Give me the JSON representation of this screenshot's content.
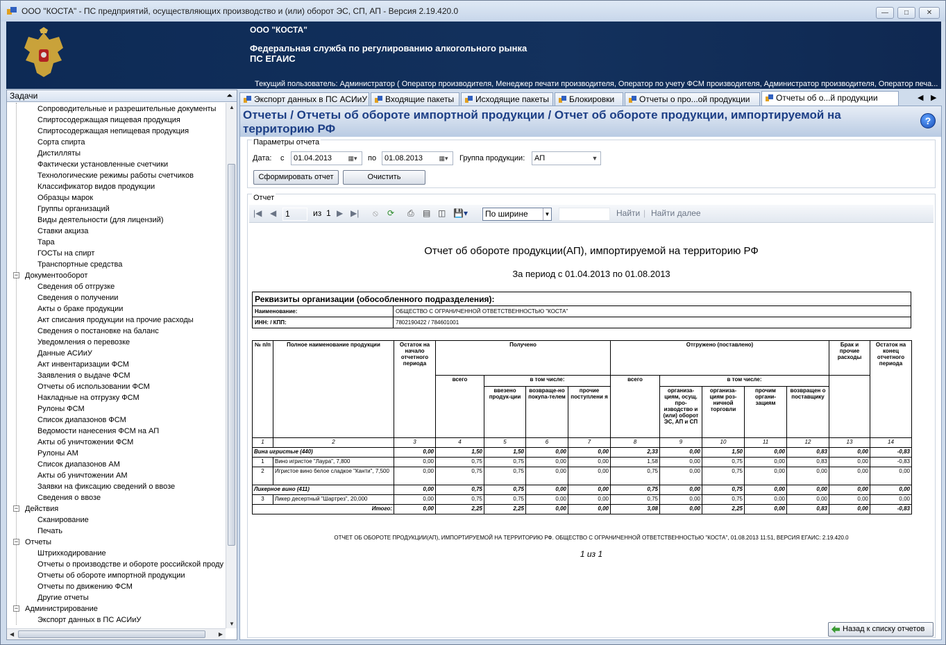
{
  "window": {
    "title": "ООО \"КОСТА\" - ПС предприятий, осуществляющих производство и (или) оборот ЭС, СП, АП - Версия 2.19.420.0",
    "min_icon": "minimize-icon",
    "max_icon": "maximize-icon",
    "close_icon": "close-icon"
  },
  "banner": {
    "org": "ООО \"КОСТА\"",
    "agency": "Федеральная служба по регулированию алкогольного рынка",
    "system": "ПС ЕГАИС",
    "user": "Текущий пользователь: Администратор ( Оператор производителя, Менеджер печати производителя, Оператор по учету ФСМ производителя, Администратор производителя, Оператор печа..."
  },
  "tasks": {
    "title": "Задачи",
    "pin": "ᚡ",
    "items": [
      {
        "label": "Сопроводительные и разрешительные документы",
        "level": 1
      },
      {
        "label": "Спиртосодержащая пищевая продукция",
        "level": 1
      },
      {
        "label": "Спиртосодержащая непищевая продукция",
        "level": 1
      },
      {
        "label": "Сорта спирта",
        "level": 1
      },
      {
        "label": "Дистилляты",
        "level": 1
      },
      {
        "label": "Фактически установленные счетчики",
        "level": 1
      },
      {
        "label": "Технологические режимы работы счетчиков",
        "level": 1
      },
      {
        "label": "Классификатор видов продукции",
        "level": 1
      },
      {
        "label": "Образцы марок",
        "level": 1
      },
      {
        "label": "Группы организаций",
        "level": 1
      },
      {
        "label": "Виды деятельности (для лицензий)",
        "level": 1
      },
      {
        "label": "Ставки акциза",
        "level": 1
      },
      {
        "label": "Тара",
        "level": 1
      },
      {
        "label": "ГОСТы на спирт",
        "level": 1
      },
      {
        "label": "Транспортные средства",
        "level": 1
      },
      {
        "label": "Документооборот",
        "level": 0
      },
      {
        "label": "Сведения об отгрузке",
        "level": 1
      },
      {
        "label": "Сведения о получении",
        "level": 1
      },
      {
        "label": "Акты о браке продукции",
        "level": 1
      },
      {
        "label": "Акт списания продукции на прочие расходы",
        "level": 1
      },
      {
        "label": "Сведения о постановке на баланс",
        "level": 1
      },
      {
        "label": "Уведомления о перевозке",
        "level": 1
      },
      {
        "label": "Данные АСИиУ",
        "level": 1
      },
      {
        "label": "Акт инвентаризации ФСМ",
        "level": 1
      },
      {
        "label": "Заявления о выдаче ФСМ",
        "level": 1
      },
      {
        "label": "Отчеты об использовании ФСМ",
        "level": 1
      },
      {
        "label": "Накладные на отгрузку ФСМ",
        "level": 1
      },
      {
        "label": "Рулоны ФСМ",
        "level": 1
      },
      {
        "label": "Список диапазонов ФСМ",
        "level": 1
      },
      {
        "label": "Ведомости нанесения ФСМ на АП",
        "level": 1
      },
      {
        "label": "Акты об уничтожении ФСМ",
        "level": 1
      },
      {
        "label": "Рулоны АМ",
        "level": 1
      },
      {
        "label": "Список диапазонов АМ",
        "level": 1
      },
      {
        "label": "Акты об уничтожении АМ",
        "level": 1
      },
      {
        "label": "Заявки на фиксацию сведений о ввозе",
        "level": 1
      },
      {
        "label": "Сведения о ввозе",
        "level": 1
      },
      {
        "label": "Действия",
        "level": 0
      },
      {
        "label": "Сканирование",
        "level": 1
      },
      {
        "label": "Печать",
        "level": 1
      },
      {
        "label": "Отчеты",
        "level": 0
      },
      {
        "label": "Штрихкодирование",
        "level": 1
      },
      {
        "label": "Отчеты о производстве и обороте российской проду",
        "level": 1
      },
      {
        "label": "Отчеты об обороте импортной продукции",
        "level": 1
      },
      {
        "label": "Отчеты по движению ФСМ",
        "level": 1
      },
      {
        "label": "Другие отчеты",
        "level": 1
      },
      {
        "label": "Администрирование",
        "level": 0
      },
      {
        "label": "Экспорт данных в ПС АСИиУ",
        "level": 1
      }
    ],
    "scroll_icon": "scrollbar"
  },
  "tabs": [
    {
      "label": "Экспорт данных в ПС АСИиУ"
    },
    {
      "label": "Входящие пакеты"
    },
    {
      "label": "Исходящие пакеты"
    },
    {
      "label": "Блокировки"
    },
    {
      "label": "Отчеты о про...ой продукции"
    },
    {
      "label": "Отчеты об о...й продукции"
    }
  ],
  "tab_nav": {
    "left": "◀",
    "right": "▶"
  },
  "page": {
    "title": "Отчеты / Отчеты об обороте импортной продукции / Отчет об обороте продукции, импортируемой на территорию РФ",
    "help": "?"
  },
  "params": {
    "legend": "Параметры отчета",
    "date_label": "Дата:",
    "from_label": "с",
    "from_value": "01.04.2013",
    "to_label": "по",
    "to_value": "01.08.2013",
    "group_label": "Группа продукции:",
    "group_value": "АП",
    "generate": "Сформировать отчет",
    "clear": "Очистить"
  },
  "report_toolbar": {
    "legend": "Отчет",
    "page_value": "1",
    "of_label": "из",
    "of_value": "1",
    "zoom": "По ширине",
    "find": "Найти",
    "find_next": "Найти далее",
    "separator": "|"
  },
  "report": {
    "title": "Отчет об обороте продукции(АП), импортируемой на территорию РФ",
    "period": "За период с 01.04.2013 по 01.08.2013",
    "req_header": "Реквизиты организации (обособленного подразделения):",
    "name_label": "Наименование:",
    "name_value": "ОБЩЕСТВО С ОГРАНИЧЕННОЙ ОТВЕТСТВЕННОСТЬЮ \"КОСТА\"",
    "inn_label": "ИНН: / КПП:",
    "inn_value": "7802190422 / 784601001",
    "h": {
      "num": "№ п/п",
      "name": "Полное наименование продукции",
      "start": "Остаток на начало отчетного периода",
      "received": "Получено",
      "shipped": "Отгружено (поставлено)",
      "defect": "Брак и прочие расходы",
      "end": "Остаток на конец отчетного периода",
      "total": "всего",
      "including": "в том числе:",
      "imported": "ввезено продук-ции",
      "returned": "возвраще-но покупа-телем",
      "other_in": "прочие поступлени я",
      "orgs": "организа-циям, осущ. про-изводство и (или) оборот ЭС, АП и СП",
      "retail": "организа-циям роз-ничной торговли",
      "other_orgs": "прочим органи-зациям",
      "supplier": "возвращен о поставщику"
    },
    "index": [
      "1",
      "2",
      "3",
      "4",
      "5",
      "6",
      "7",
      "8",
      "9",
      "10",
      "11",
      "12",
      "13",
      "14"
    ],
    "rows": [
      {
        "type": "group",
        "name": "Вина игристые (440)",
        "v": [
          "0,00",
          "1,50",
          "1,50",
          "0,00",
          "0,00",
          "2,33",
          "0,00",
          "1,50",
          "0,00",
          "0,83",
          "0,00",
          "-0,83"
        ]
      },
      {
        "type": "item",
        "n": "1",
        "name": "Вино игристое \"Лаура\", 7,800",
        "v": [
          "0,00",
          "0,75",
          "0,75",
          "0,00",
          "0,00",
          "1,58",
          "0,00",
          "0,75",
          "0,00",
          "0,83",
          "0,00",
          "-0,83"
        ]
      },
      {
        "type": "item",
        "n": "2",
        "name": "Игристое вино белое сладкое \"Канти\", 7,500",
        "v": [
          "0,00",
          "0,75",
          "0,75",
          "0,00",
          "0,00",
          "0,75",
          "0,00",
          "0,75",
          "0,00",
          "0,00",
          "0,00",
          "0,00"
        ]
      },
      {
        "type": "group",
        "name": "Ликерное вино (411)",
        "v": [
          "0,00",
          "0,75",
          "0,75",
          "0,00",
          "0,00",
          "0,75",
          "0,00",
          "0,75",
          "0,00",
          "0,00",
          "0,00",
          "0,00"
        ]
      },
      {
        "type": "item",
        "n": "3",
        "name": "Ликер десертный \"Шартрез\", 20,000",
        "v": [
          "0,00",
          "0,75",
          "0,75",
          "0,00",
          "0,00",
          "0,75",
          "0,00",
          "0,75",
          "0,00",
          "0,00",
          "0,00",
          "0,00"
        ]
      },
      {
        "type": "total",
        "name": "Итого:",
        "v": [
          "0,00",
          "2,25",
          "2,25",
          "0,00",
          "0,00",
          "3,08",
          "0,00",
          "2,25",
          "0,00",
          "0,83",
          "0,00",
          "-0,83"
        ]
      }
    ],
    "footer": "ОТЧЕТ ОБ ОБОРОТЕ ПРОДУКЦИИ(АП), ИМПОРТИРУЕМОЙ НА ТЕРРИТОРИЮ РФ. ОБЩЕСТВО С ОГРАНИЧЕННОЙ ОТВЕТСТВЕННОСТЬЮ \"КОСТА\", 01.08.2013 11:51, ВЕРСИЯ ЕГАИС: 2.19.420.0",
    "page_info": "1 из 1"
  },
  "back_button": "Назад к списку отчетов"
}
